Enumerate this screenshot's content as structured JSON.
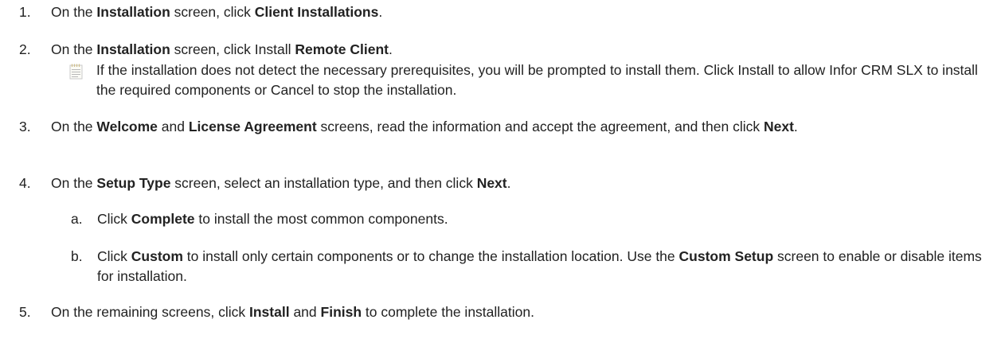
{
  "steps": [
    {
      "num": "1.",
      "p1": "On the ",
      "b1": "Installation",
      "p2": " screen, click ",
      "b2": "Client Installations",
      "p3": "."
    },
    {
      "num": "2.",
      "p1": "On the ",
      "b1": "Installation",
      "p2": " screen, click Install ",
      "b2": "Remote Client",
      "p3": ".",
      "note": {
        "icon": "note-icon",
        "text": "If the installation does not detect the necessary prerequisites, you will be prompted to install them. Click Install to allow Infor CRM SLX to install the required components or Cancel to stop the installation."
      }
    },
    {
      "num": "3.",
      "p1": "On the ",
      "b1": "Welcome",
      "p2": " and ",
      "b2": "License Agreement",
      "p3": " screens, read the information and accept the agreement, and then click ",
      "b3": "Next",
      "p4": "."
    },
    {
      "num": "4.",
      "p1": "On the ",
      "b1": "Setup Type",
      "p2": " screen, select an installation type, and then click ",
      "b2": "Next",
      "p3": ".",
      "substeps": [
        {
          "num": "a.",
          "p1": "Click ",
          "b1": "Complete",
          "p2": " to install the most common components."
        },
        {
          "num": "b.",
          "p1": "Click ",
          "b1": "Custom",
          "p2": " to install only certain components or to change the installation location. Use the ",
          "b2": "Custom Setup",
          "p3": " screen to enable or disable items for installation."
        }
      ]
    },
    {
      "num": "5.",
      "p1": "On the remaining screens, click ",
      "b1": "Install",
      "p2": " and ",
      "b2": "Finish",
      "p3": " to complete the installation."
    }
  ],
  "colors": {
    "text": "#222222",
    "note_icon_line": "#b8b8b8",
    "note_icon_ring": "#d2c08a"
  }
}
